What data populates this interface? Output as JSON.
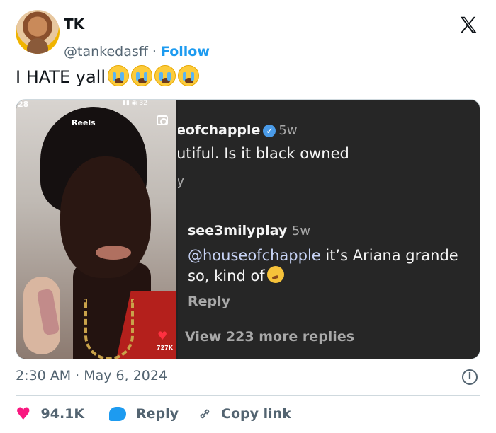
{
  "author": {
    "name": "TK",
    "handle": "@tankedasff",
    "separator": "·",
    "follow_label": "Follow"
  },
  "tweet": {
    "text": "I HATE yall",
    "emoji_count": 4,
    "emoji_name": "loudly-crying-face"
  },
  "media": {
    "phone_status_time": "28",
    "phone_status_icons": "▮▮ ◉ 32",
    "reels_label": "Reels",
    "reel_like_count": "727K",
    "comment1": {
      "user": "eofchapple",
      "verified": true,
      "ago": "5w",
      "text": "utiful.  Is it black owned",
      "reply_fragment": "y"
    },
    "comment2": {
      "user": "see3milyplay",
      "ago": "5w",
      "mention": "@houseofchapple",
      "line1_rest": " it’s Ariana grande",
      "line2": "so, kind of",
      "reply_label": "Reply"
    },
    "more_replies": "View 223 more replies"
  },
  "footer": {
    "timestamp": "2:30 AM · May 6, 2024",
    "info_glyph": "i",
    "like_count": "94.1K",
    "reply_label": "Reply",
    "copy_link_label": "Copy link"
  },
  "colors": {
    "accent": "#1d9bf0",
    "like": "#f91880",
    "muted": "#536471",
    "comment_bg": "#262626"
  }
}
